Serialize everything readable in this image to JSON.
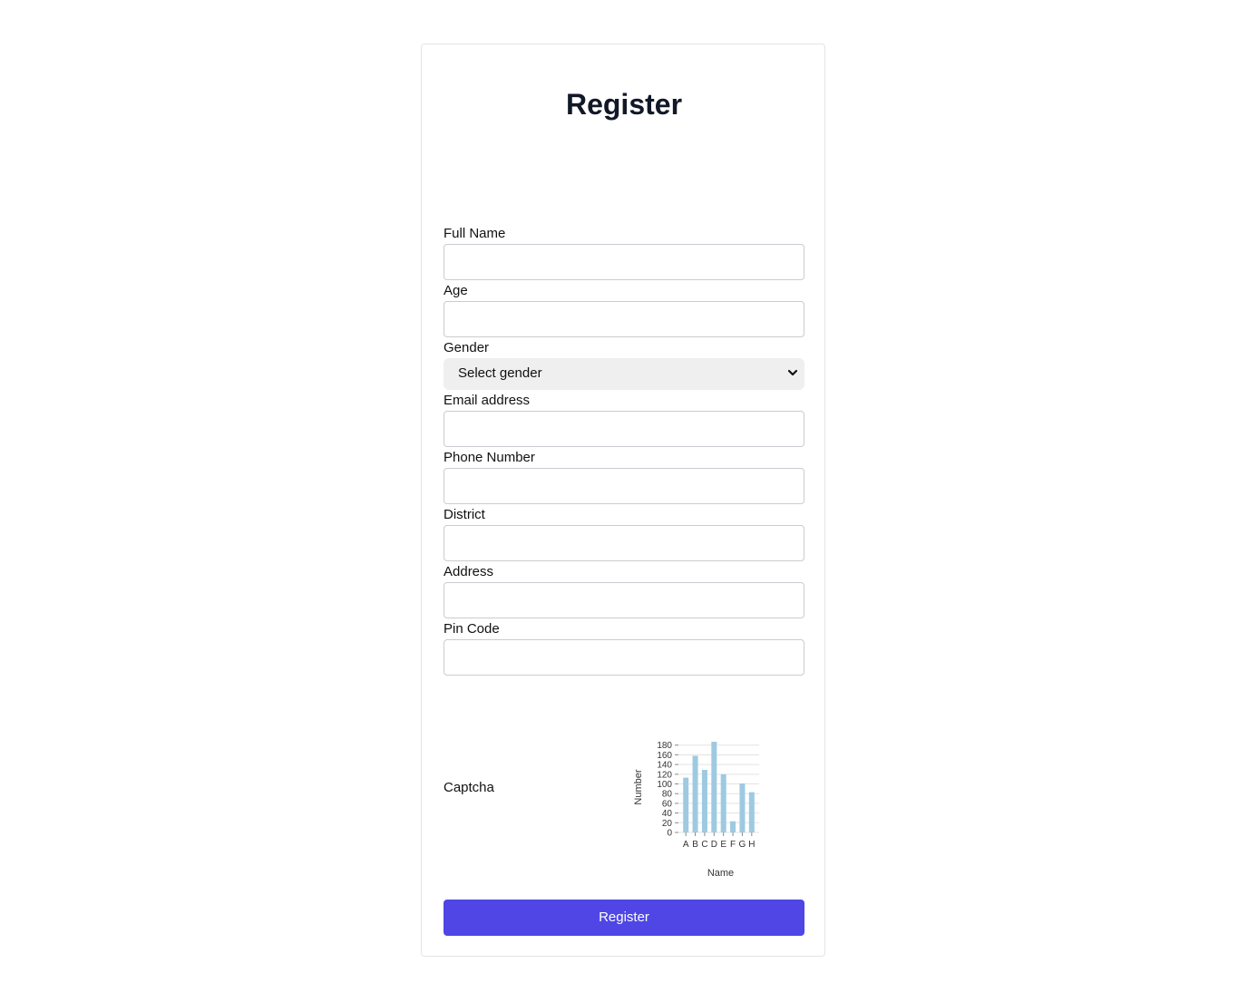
{
  "form": {
    "title": "Register",
    "fields": {
      "full_name": {
        "label": "Full Name",
        "value": ""
      },
      "age": {
        "label": "Age",
        "value": ""
      },
      "gender": {
        "label": "Gender",
        "selected": "Select gender"
      },
      "email": {
        "label": "Email address",
        "value": ""
      },
      "phone": {
        "label": "Phone Number",
        "value": ""
      },
      "district": {
        "label": "District",
        "value": ""
      },
      "address": {
        "label": "Address",
        "value": ""
      },
      "pin_code": {
        "label": "Pin Code",
        "value": ""
      }
    },
    "captcha_label": "Captcha",
    "submit_label": "Register"
  },
  "colors": {
    "accent": "#4f46e5",
    "bar": "#9ecae1"
  },
  "chart_data": {
    "type": "bar",
    "categories": [
      "A",
      "B",
      "C",
      "D",
      "E",
      "F",
      "G",
      "H"
    ],
    "values": [
      113,
      158,
      129,
      187,
      120,
      23,
      101,
      83
    ],
    "ticks": [
      0,
      20,
      40,
      60,
      80,
      100,
      120,
      140,
      160,
      180
    ],
    "tick_labels": [
      "0",
      "20",
      "40",
      "60",
      "80",
      "100",
      "120",
      "140",
      "160",
      "180"
    ],
    "title": "",
    "xlabel": "Name",
    "ylabel": "Number",
    "ylim": [
      0,
      187
    ],
    "grid": true
  }
}
